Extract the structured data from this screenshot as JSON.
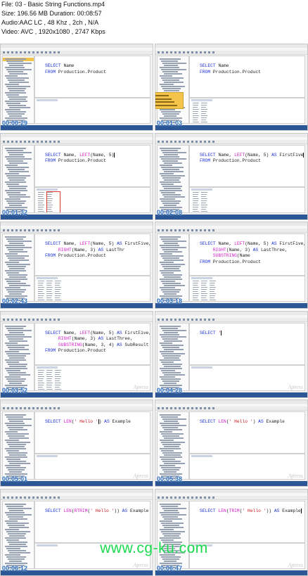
{
  "file_info": {
    "line1": "File: 03 - Basic String Functions.mp4",
    "line2": "Size: 196.56 MB Duration: 00:08:57",
    "line3": "Audio:AAC LC , 48 Khz , 2ch , N/A",
    "line4": "Video: AVC , 1920x1080 , 2747 Kbps"
  },
  "watermark": "www.cg-ku.com",
  "brand": "Apress",
  "colors": {
    "keyword": "#1a2fd6",
    "function": "#d11ac8",
    "string": "#c2151b",
    "timestamp": "#2b6fc3",
    "watermark": "#19d94d"
  },
  "frames": [
    {
      "timestamp": "00:00:29",
      "code": [
        [
          "kw",
          "SELECT"
        ],
        [
          "t",
          " Name\n"
        ],
        [
          "kw",
          "FROM"
        ],
        [
          "t",
          " Production.Product"
        ]
      ]
    },
    {
      "timestamp": "00:01:03",
      "code": [
        [
          "kw",
          "SELECT"
        ],
        [
          "t",
          " Name\n"
        ],
        [
          "kw",
          "FROM"
        ],
        [
          "t",
          " Production.Product"
        ]
      ]
    },
    {
      "timestamp": "00:01:32",
      "code": [
        [
          "kw",
          "SELECT"
        ],
        [
          "t",
          " Name, "
        ],
        [
          "fn",
          "LEFT"
        ],
        [
          "t",
          "(Name, 5)"
        ],
        [
          "caret",
          ""
        ],
        [
          "t",
          "\n"
        ],
        [
          "kw",
          "FROM"
        ],
        [
          "t",
          " Production.Product"
        ]
      ]
    },
    {
      "timestamp": "00:02:08",
      "code": [
        [
          "kw",
          "SELECT"
        ],
        [
          "t",
          " Name, "
        ],
        [
          "fn",
          "LEFT"
        ],
        [
          "t",
          "(Name, 5) "
        ],
        [
          "kw",
          "AS"
        ],
        [
          "t",
          " FirstFive"
        ],
        [
          "caret",
          ""
        ],
        [
          "t",
          "\n"
        ],
        [
          "kw",
          "FROM"
        ],
        [
          "t",
          " Production.Product"
        ]
      ]
    },
    {
      "timestamp": "00:02:43",
      "code": [
        [
          "kw",
          "SELECT"
        ],
        [
          "t",
          " Name, "
        ],
        [
          "fn",
          "LEFT"
        ],
        [
          "t",
          "(Name, 5) "
        ],
        [
          "kw",
          "AS"
        ],
        [
          "t",
          " FirstFive,\n     "
        ],
        [
          "fn",
          "RIGHT"
        ],
        [
          "t",
          "(Name, 3) "
        ],
        [
          "kw",
          "AS"
        ],
        [
          "t",
          " LastThr\n"
        ],
        [
          "kw",
          "FROM"
        ],
        [
          "t",
          " Production.Product"
        ]
      ]
    },
    {
      "timestamp": "00:03:18",
      "code": [
        [
          "kw",
          "SELECT"
        ],
        [
          "t",
          " Name, "
        ],
        [
          "fn",
          "LEFT"
        ],
        [
          "t",
          "(Name, 5) "
        ],
        [
          "kw",
          "AS"
        ],
        [
          "t",
          " FirstFive,\n     "
        ],
        [
          "fn",
          "RIGHT"
        ],
        [
          "t",
          "(Name, 3) "
        ],
        [
          "kw",
          "AS"
        ],
        [
          "t",
          " LastThree,\n     "
        ],
        [
          "fn",
          "SUBSTRING"
        ],
        [
          "t",
          "(Name\n"
        ],
        [
          "kw",
          "FROM"
        ],
        [
          "t",
          " Production.Product"
        ]
      ]
    },
    {
      "timestamp": "00:03:52",
      "code": [
        [
          "kw",
          "SELECT"
        ],
        [
          "t",
          " Name, "
        ],
        [
          "fn",
          "LEFT"
        ],
        [
          "t",
          "(Name, 5) "
        ],
        [
          "kw",
          "AS"
        ],
        [
          "t",
          " FirstFive,\n     "
        ],
        [
          "fn",
          "RIGHT"
        ],
        [
          "t",
          "(Name, 3) "
        ],
        [
          "kw",
          "AS"
        ],
        [
          "t",
          " LastThree,\n     "
        ],
        [
          "fn",
          "SUBSTRING"
        ],
        [
          "t",
          "(Name, 3, 4) "
        ],
        [
          "kw",
          "AS"
        ],
        [
          "t",
          " SubResult\n"
        ],
        [
          "kw",
          "FROM"
        ],
        [
          "t",
          " Production.Product"
        ]
      ]
    },
    {
      "timestamp": "00:04:28",
      "code": [
        [
          "kw",
          "SELECT"
        ],
        [
          "t",
          " "
        ],
        [
          "str",
          "'"
        ],
        [
          "caret",
          ""
        ]
      ]
    },
    {
      "timestamp": "00:05:01",
      "code": [
        [
          "kw",
          "SELECT"
        ],
        [
          "t",
          " "
        ],
        [
          "fn",
          "LEN"
        ],
        [
          "t",
          "("
        ],
        [
          "str",
          "' Hello '"
        ],
        [
          "caret",
          ""
        ],
        [
          "t",
          ") "
        ],
        [
          "kw",
          "AS"
        ],
        [
          "t",
          " Example"
        ]
      ]
    },
    {
      "timestamp": "00:05:38",
      "code": [
        [
          "kw",
          "SELECT"
        ],
        [
          "t",
          " "
        ],
        [
          "fn",
          "LEN"
        ],
        [
          "t",
          "("
        ],
        [
          "str",
          "' Hello '"
        ],
        [
          "t",
          ") "
        ],
        [
          "kw",
          "AS"
        ],
        [
          "t",
          " Example"
        ]
      ]
    },
    {
      "timestamp": "00:06:12",
      "code": [
        [
          "kw",
          "SELECT"
        ],
        [
          "t",
          " "
        ],
        [
          "fn",
          "LEN"
        ],
        [
          "t",
          "("
        ],
        [
          "fn",
          "RTRIM"
        ],
        [
          "t",
          "("
        ],
        [
          "str",
          "' Hello '"
        ],
        [
          "t",
          ")) "
        ],
        [
          "kw",
          "AS"
        ],
        [
          "t",
          " Example"
        ]
      ]
    },
    {
      "timestamp": "00:06:47",
      "code": [
        [
          "kw",
          "SELECT"
        ],
        [
          "t",
          " "
        ],
        [
          "fn",
          "LEN"
        ],
        [
          "t",
          "("
        ],
        [
          "fn",
          "TRIM"
        ],
        [
          "t",
          "("
        ],
        [
          "str",
          "' Hello '"
        ],
        [
          "t",
          ")) "
        ],
        [
          "kw",
          "AS"
        ],
        [
          "t",
          " Example"
        ],
        [
          "caret",
          ""
        ]
      ]
    }
  ]
}
